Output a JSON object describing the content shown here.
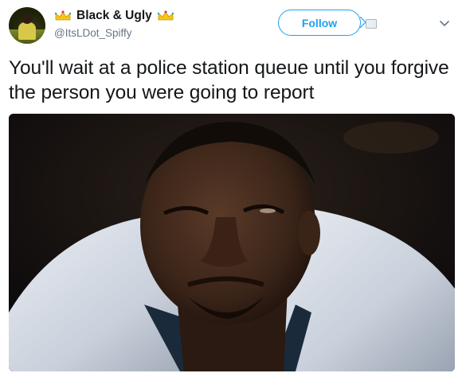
{
  "user": {
    "display_name": "Black & Ugly",
    "handle": "@ItsLDot_Spiffy",
    "avatar_icon": "avatar-photo",
    "badge_icon": "crown-emoji"
  },
  "actions": {
    "follow_label": "Follow"
  },
  "tweet": {
    "text": "You'll wait at a police station queue until you forgive the person you were going to report"
  },
  "media": {
    "icon": "photo"
  },
  "colors": {
    "accent": "#1da1f2",
    "text": "#14171a",
    "secondary": "#657786"
  }
}
